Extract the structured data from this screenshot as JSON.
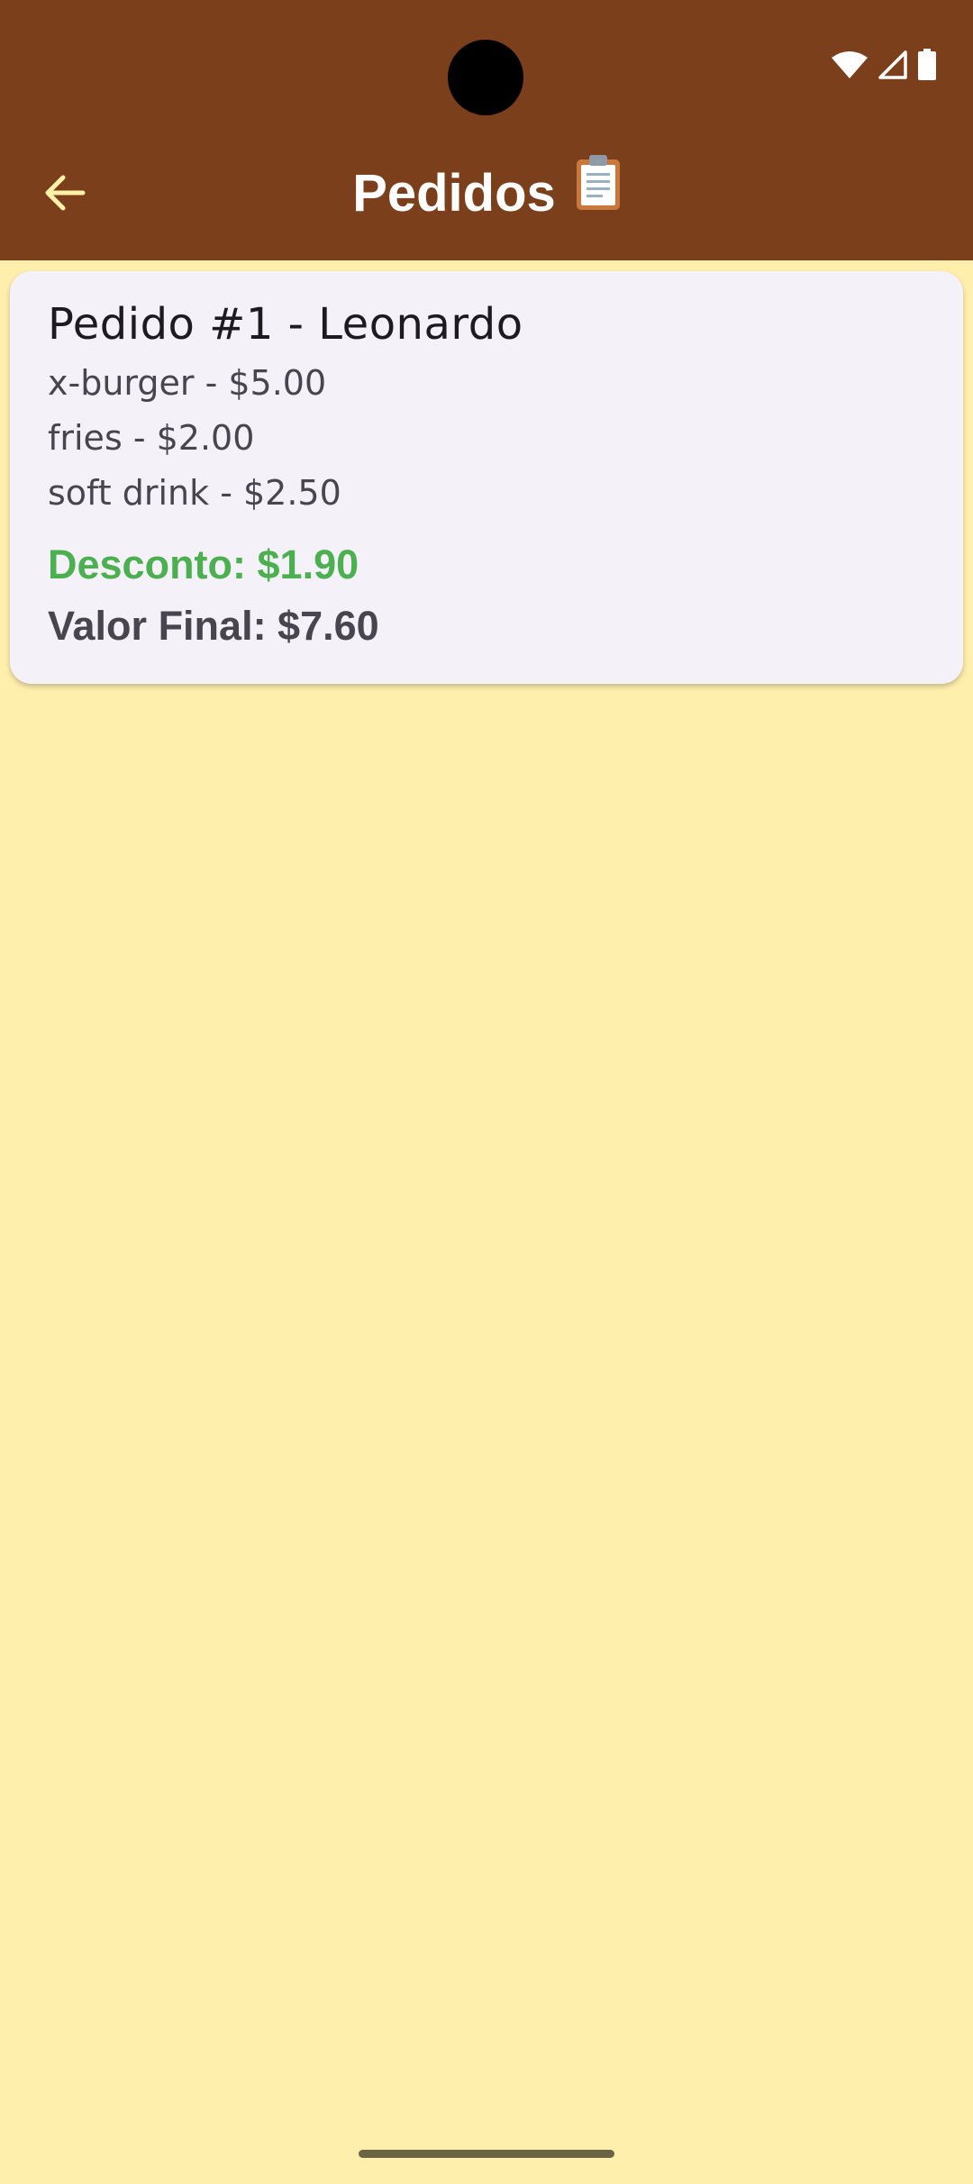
{
  "colors": {
    "appbar": "#7B3F1C",
    "background": "#FFEFAD",
    "card": "#F5F1F9",
    "back_arrow": "#FFF1A8",
    "discount": "#4CAF50"
  },
  "status_bar": {
    "icons": [
      "wifi-icon",
      "cellular-signal-icon",
      "battery-icon"
    ]
  },
  "appbar": {
    "back_icon": "arrow-left-icon",
    "title": "Pedidos",
    "title_emoji_icon": "clipboard-icon"
  },
  "orders": [
    {
      "title": "Pedido #1 - Leonardo",
      "items": [
        "x-burger - $5.00",
        "fries - $2.00",
        "soft drink - $2.50"
      ],
      "discount": "Desconto: $1.90",
      "final": "Valor Final: $7.60"
    }
  ]
}
